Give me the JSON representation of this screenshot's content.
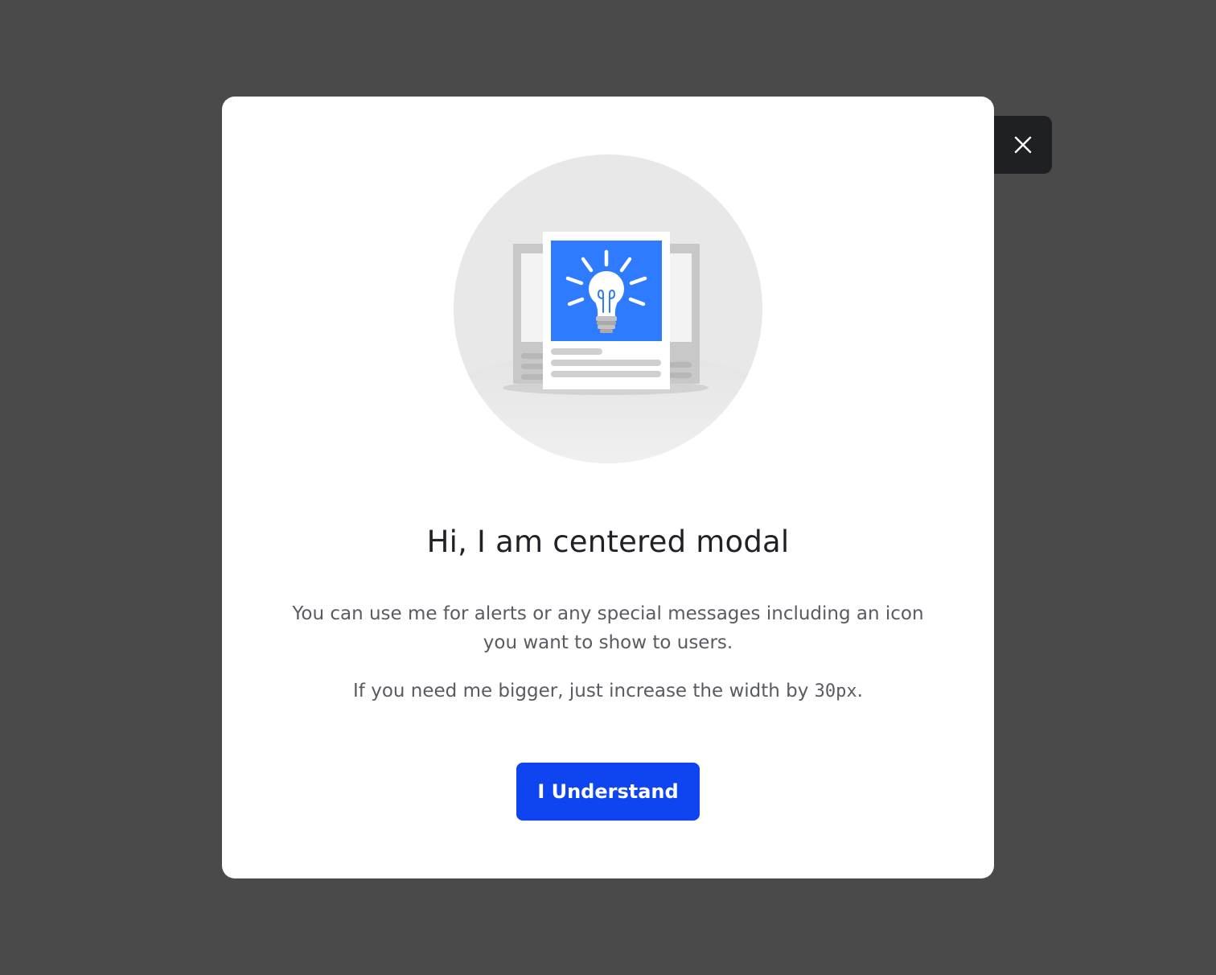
{
  "overlay": {
    "background_color": "#4a4a4a"
  },
  "modal": {
    "title": "Hi, I am centered modal",
    "message": "You can use me for alerts or any special messages including an icon you want to show to users.",
    "note_prefix": "If you need me bigger, just increase the width by ",
    "note_code": "30px",
    "note_suffix": ".",
    "primary_button_label": "I Understand",
    "illustration_icon": "lightbulb-icon",
    "close_icon": "close-icon"
  },
  "colors": {
    "primary": "#0f45f0",
    "close_button_bg": "#1e2024",
    "illustration_accent": "#2f7bff",
    "title_text": "#1f2126",
    "body_text": "#585b61"
  }
}
